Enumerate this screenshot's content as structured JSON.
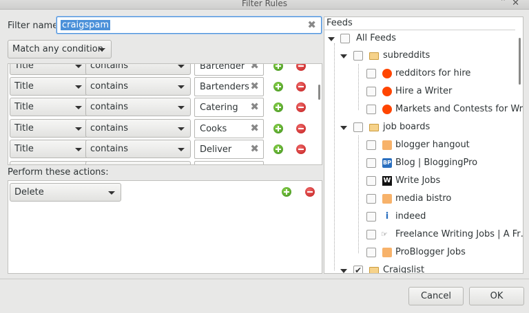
{
  "window": {
    "title": "Filter Rules"
  },
  "filter": {
    "label": "Filter name:",
    "value": "craigspam"
  },
  "match": {
    "value": "Match any condition"
  },
  "rules": [
    {
      "field": "Title",
      "op": "contains",
      "value": "Bartender"
    },
    {
      "field": "Title",
      "op": "contains",
      "value": "Bartenders"
    },
    {
      "field": "Title",
      "op": "contains",
      "value": "Catering"
    },
    {
      "field": "Title",
      "op": "contains",
      "value": "Cooks"
    },
    {
      "field": "Title",
      "op": "contains",
      "value": "Deliver"
    }
  ],
  "actions": {
    "label": "Perform these actions:",
    "items": [
      {
        "value": "Delete"
      }
    ]
  },
  "feeds": {
    "header": "Feeds",
    "items": [
      {
        "label": "All Feeds",
        "icon": "none",
        "checked": false,
        "expanded": true
      },
      {
        "label": "subreddits",
        "icon": "folder-icon",
        "checked": false,
        "expanded": true
      },
      {
        "label": "redditors for hire",
        "icon": "reddit-icon",
        "checked": false
      },
      {
        "label": "Hire a Writer",
        "icon": "reddit-icon",
        "checked": false
      },
      {
        "label": "Markets and Contests for Wri…",
        "icon": "reddit-icon",
        "checked": false
      },
      {
        "label": "job boards",
        "icon": "folder-icon",
        "checked": false,
        "expanded": true
      },
      {
        "label": "blogger hangout",
        "icon": "rss-icon",
        "checked": false
      },
      {
        "label": "Blog | BloggingPro",
        "icon": "bloggingpro-icon",
        "checked": false
      },
      {
        "label": "Write Jobs",
        "icon": "writejobs-icon",
        "checked": false
      },
      {
        "label": "media bistro",
        "icon": "rss-icon",
        "checked": false
      },
      {
        "label": "indeed",
        "icon": "indeed-icon",
        "checked": false
      },
      {
        "label": "Freelance Writing Jobs | A Fr…",
        "icon": "fwj-icon",
        "checked": false
      },
      {
        "label": "ProBlogger Jobs",
        "icon": "rss-icon",
        "checked": false
      },
      {
        "label": "Craigslist",
        "icon": "folder-icon",
        "checked": true,
        "expanded": true
      }
    ]
  },
  "buttons": {
    "cancel": "Cancel",
    "ok": "OK"
  },
  "colors": {
    "accent": "#4a90d9",
    "add": "#4ea626",
    "remove": "#d42424"
  }
}
